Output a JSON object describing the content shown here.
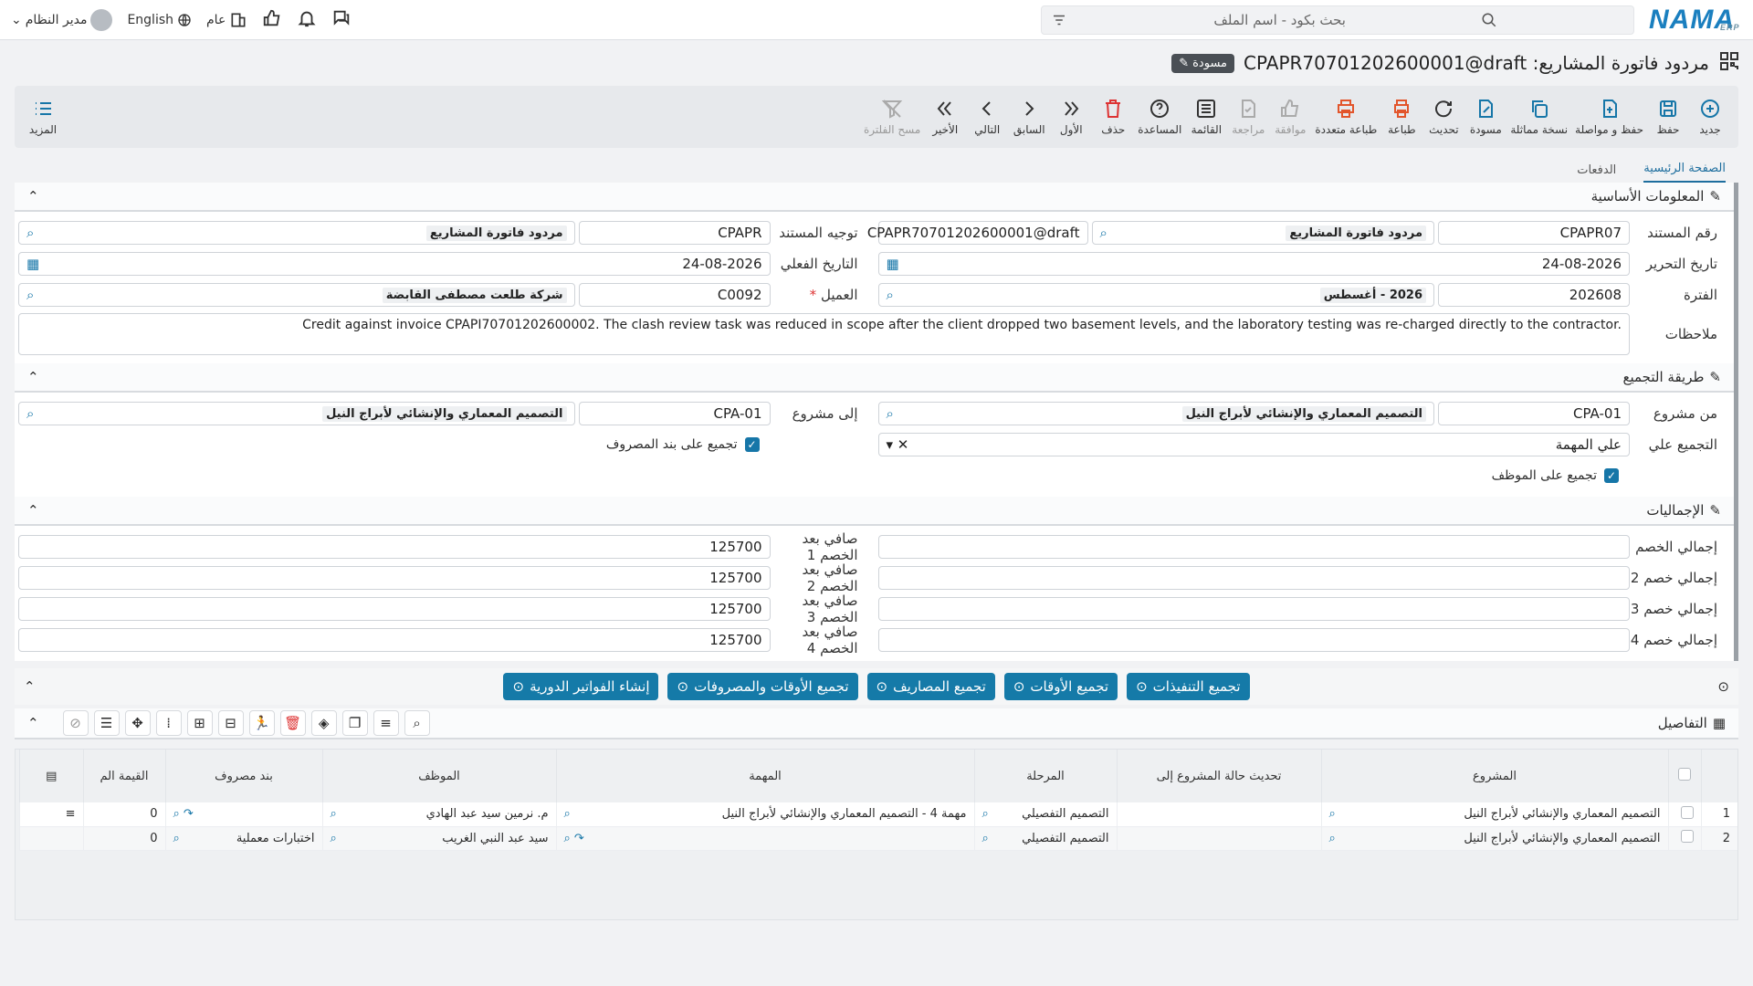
{
  "topbar": {
    "search_placeholder": "بحث بكود - اسم الملف",
    "user": "مدير النظام",
    "language": "English",
    "scope": "عام",
    "logo": "NAMA",
    "logo_sub": "ERP"
  },
  "title": {
    "text": "مردود فاتورة المشاريع: CPAPR70701202600001@draft",
    "status": "مسودة"
  },
  "toolbar": {
    "items": [
      "جديد",
      "حفظ",
      "حفظ و مواصلة",
      "نسخة مماثلة",
      "مسودة",
      "تحديث",
      "طباعة",
      "طباعة متعددة",
      "موافقة",
      "مراجعة",
      "القائمة",
      "المساعدة",
      "حذف",
      "الأول",
      "السابق",
      "التالي",
      "الأخير",
      "مسح الفلترة"
    ],
    "more": "المزيد"
  },
  "tabs": [
    "الصفحة الرئيسية",
    "الدفعات"
  ],
  "basic": {
    "title": "المعلومات الأساسية",
    "doc_no_label": "رقم المستند",
    "doc_no_code": "CPAPR07",
    "doc_no_type": "مردود فاتورة المشاريع",
    "doc_no_value": "CPAPR70701202600001@draft",
    "direction_label": "توجيه المستند",
    "direction_code": "CPAPR",
    "direction_name": "مردود فاتورة المشاريع",
    "edit_date_label": "تاريخ التحرير",
    "edit_date": "24-08-2026",
    "actual_date_label": "التاريخ الفعلي",
    "actual_date": "24-08-2026",
    "period_label": "الفترة",
    "period_code": "202608",
    "period_name": "2026 - أغسطس",
    "customer_label": "العميل",
    "customer_code": "C0092",
    "customer_name": "شركة طلعت مصطفى القابضة",
    "notes_label": "ملاحظات",
    "notes": "Credit against invoice CPAPI70701202600002. The clash review task was reduced in scope after the client dropped two basement levels, and the laboratory testing was re-charged directly to the contractor."
  },
  "grouping": {
    "title": "طريقة التجميع",
    "from_label": "من مشروع",
    "from_code": "CPA-01",
    "from_name": "التصميم المعماري والإنشائي لأبراج النيل",
    "to_label": "إلى مشروع",
    "to_code": "CPA-01",
    "to_name": "التصميم المعماري والإنشائي لأبراج النيل",
    "group_on_label": "التجميع علي",
    "group_on_value": "علي المهمة",
    "expense_check": "تجميع على بند المصروف",
    "employee_check": "تجميع على الموظف"
  },
  "totals": {
    "title": "الإجماليات",
    "rows": [
      {
        "l": "إجمالي الخصم",
        "r_label": "صافي بعد الخصم 1",
        "r": "125700"
      },
      {
        "l": "إجمالي خصم 2",
        "r_label": "صافي بعد الخصم 2",
        "r": "125700"
      },
      {
        "l": "إجمالي خصم 3",
        "r_label": "صافي بعد الخصم 3",
        "r": "125700"
      },
      {
        "l": "إجمالي خصم 4",
        "r_label": "صافي بعد الخصم 4",
        "r": "125700"
      }
    ]
  },
  "actions": [
    "تجميع التنفيذات",
    "تجميع الأوقات",
    "تجميع المصاريف",
    "تجميع الأوقات والمصروفات",
    "إنشاء الفواتير الدورية"
  ],
  "details": {
    "title": "التفاصيل",
    "columns": [
      "المشروع",
      "تحديث حالة المشروع إلى",
      "المرحلة",
      "المهمة",
      "الموظف",
      "بند مصروف",
      "القيمة الم"
    ],
    "rows": [
      {
        "n": "1",
        "project": "التصميم المعماري والإنشائي لأبراج النيل",
        "status": "",
        "phase": "التصميم التفصيلي",
        "task": "مهمة 4 - التصميم المعماري والإنشائي لأبراج النيل",
        "employee": "م. نرمين سيد عبد الهادي",
        "expense": "",
        "value": "0"
      },
      {
        "n": "2",
        "project": "التصميم المعماري والإنشائي لأبراج النيل",
        "status": "",
        "phase": "التصميم التفصيلي",
        "task": "",
        "employee": "سيد عبد النبي الغريب",
        "expense": "اختبارات معملية",
        "value": "0"
      }
    ]
  }
}
